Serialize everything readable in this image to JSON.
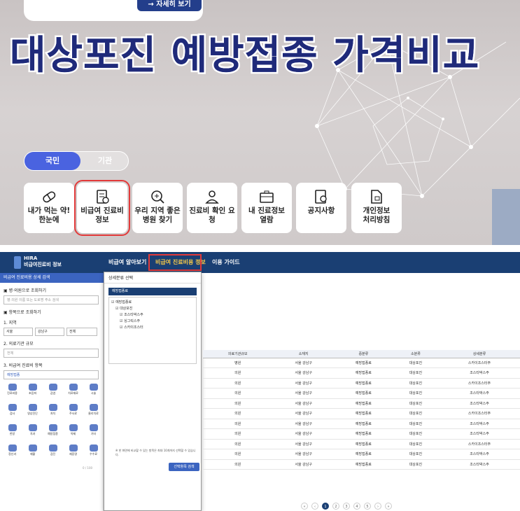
{
  "hero": {
    "detail_button": "→ 자세히 보기",
    "headline": "대상포진 예방접종 가격비교",
    "toggle": {
      "on": "국민",
      "off": "기관"
    },
    "services": [
      {
        "icon": "pill-icon",
        "label": "내가 먹는 약!\n한눈에"
      },
      {
        "icon": "receipt-icon",
        "label": "비급여 진료비\n정보"
      },
      {
        "icon": "search-plus-icon",
        "label": "우리 지역 좋은\n병원 찾기"
      },
      {
        "icon": "person-check-icon",
        "label": "진료비 확인 요청"
      },
      {
        "icon": "briefcase-icon",
        "label": "내 진료정보\n열람"
      },
      {
        "icon": "notice-icon",
        "label": "공지사항"
      },
      {
        "icon": "privacy-doc-icon",
        "label": "개인정보\n처리방침"
      }
    ]
  },
  "site": {
    "logo_top": "HIRA",
    "logo_sub": "비급여진료비 정보",
    "nav": [
      "비급여 알아보기",
      "비급여 진료비용 정보",
      "이용 가이드"
    ],
    "left_panel": {
      "head": "비급여 진료비용 상세 검색",
      "sec1": "▣ 병·의원으로 조회하기",
      "search_placeholder": "병·의원 이름 또는 도로명 주소 검색",
      "sec2": "▣ 항목으로 조회하기",
      "sub1": "1. 지역",
      "regions": [
        "서울",
        "강남구",
        "전체"
      ],
      "sub2": "2. 의료기관 규모",
      "scale": "전체",
      "sub3": "3. 비급여 진료비 항목",
      "item_search": "예방접종",
      "icons": [
        "진료비용",
        "초음파",
        "감염",
        "치료재료",
        "시술",
        "검사",
        "영상진단",
        "처치",
        "주사료",
        "물리치료",
        "한방",
        "치과",
        "예방접종",
        "약제",
        "기타",
        "정신과",
        "재활",
        "검진",
        "제증명",
        "수수료"
      ],
      "counter": "0 / 100"
    },
    "popup": {
      "title": "상세분류 선택",
      "bar": "예방접종료",
      "tree": [
        "예방접종료",
        "대상포진",
        "조스타박스주",
        "싱그릭스주",
        "스카이조스터"
      ],
      "note": "※ 한 화면에 비교할 수 있는 항목은 최대 10개까지 선택할 수 있습니다.",
      "button": "선택항목 검색"
    },
    "table": {
      "headers": [
        "의료기관규모",
        "소재지",
        "중분류",
        "소분류",
        "상세분류"
      ],
      "rows": [
        [
          "병원",
          "서울 강남구",
          "예방접종료",
          "대상포진",
          "스카이조스터주"
        ],
        [
          "의원",
          "서울 강남구",
          "예방접종료",
          "대상포진",
          "조스타박스주"
        ],
        [
          "의원",
          "서울 강남구",
          "예방접종료",
          "대상포진",
          "스카이조스터주"
        ],
        [
          "의원",
          "서울 강남구",
          "예방접종료",
          "대상포진",
          "조스타박스주"
        ],
        [
          "의원",
          "서울 강남구",
          "예방접종료",
          "대상포진",
          "조스타박스주"
        ],
        [
          "의원",
          "서울 강남구",
          "예방접종료",
          "대상포진",
          "스카이조스터주"
        ],
        [
          "의원",
          "서울 강남구",
          "예방접종료",
          "대상포진",
          "조스타박스주"
        ],
        [
          "의원",
          "서울 강남구",
          "예방접종료",
          "대상포진",
          "조스타박스주"
        ],
        [
          "의원",
          "서울 강남구",
          "예방접종료",
          "대상포진",
          "스카이조스터주"
        ],
        [
          "의원",
          "서울 강남구",
          "예방접종료",
          "대상포진",
          "조스타박스주"
        ],
        [
          "의원",
          "서울 강남구",
          "예방접종료",
          "대상포진",
          "조스타박스주"
        ]
      ]
    },
    "pager": [
      "«",
      "‹",
      "1",
      "2",
      "3",
      "4",
      "5",
      "›",
      "»"
    ]
  },
  "colors": {
    "headline": "#1f2a7a",
    "highlight": "#e23a3a",
    "nav_bg": "#1a3f73",
    "toggle_on": "#4a63e0"
  }
}
